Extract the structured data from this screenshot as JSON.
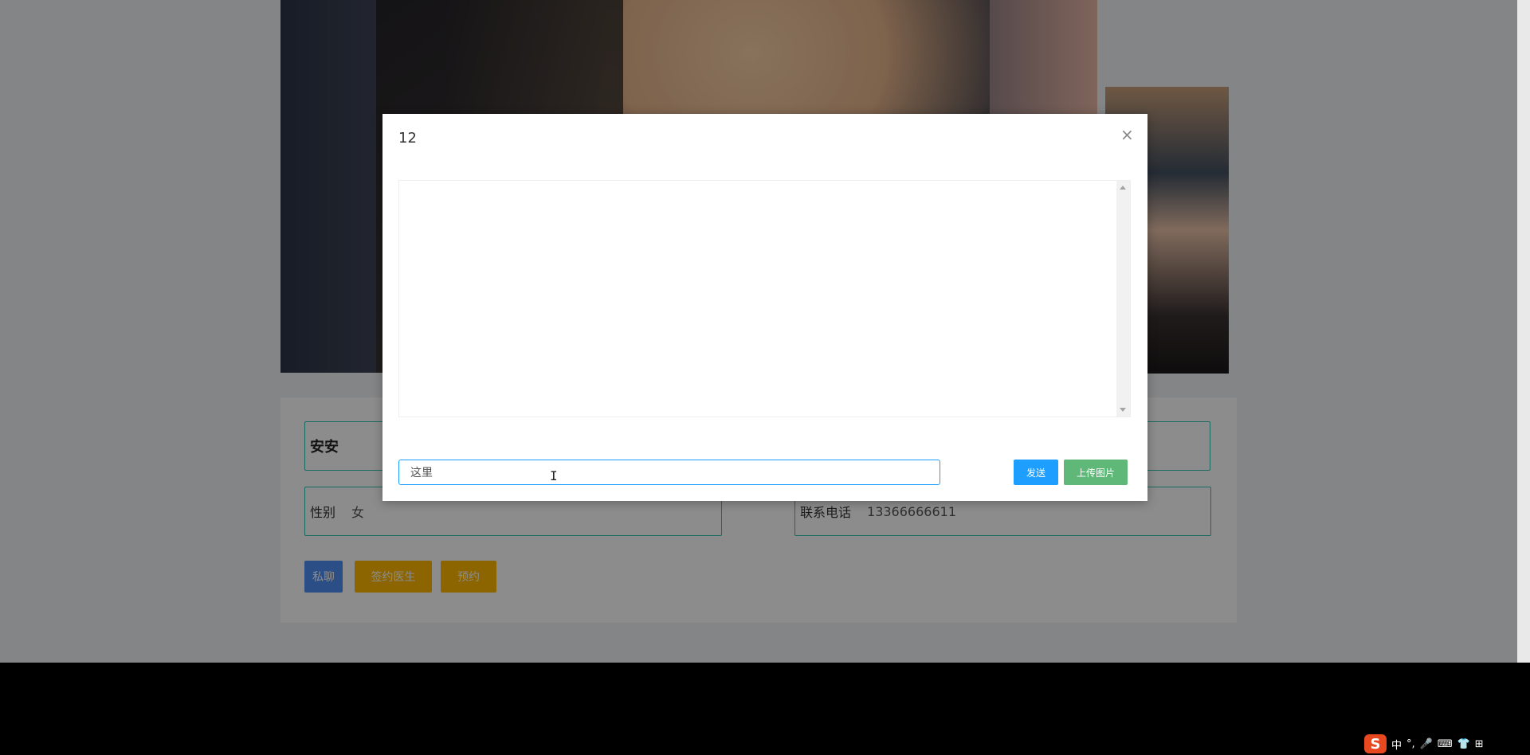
{
  "profile": {
    "name": "安安",
    "gender_label": "性别",
    "gender_value": "女",
    "phone_label": "联系电话",
    "phone_value": "13366666611"
  },
  "actions": {
    "chat": "私聊",
    "sign_doctor": "签约医生",
    "book": "预约"
  },
  "modal": {
    "title": "12",
    "close": "×",
    "input_value": "这里",
    "send": "发送",
    "upload": "上传图片"
  },
  "tray": {
    "ime_logo": "S",
    "ime_lang": "中",
    "ime_punct": "°,",
    "mic": "🎤",
    "keyboard": "⌨",
    "skin": "👕",
    "grid": "⊞"
  },
  "colors": {
    "accent_teal": "#2fc2b1",
    "chat_button": "#4f8ff6",
    "warm_button": "#ffb800",
    "send_button": "#1e9fff",
    "upload_button": "#5fb878"
  }
}
